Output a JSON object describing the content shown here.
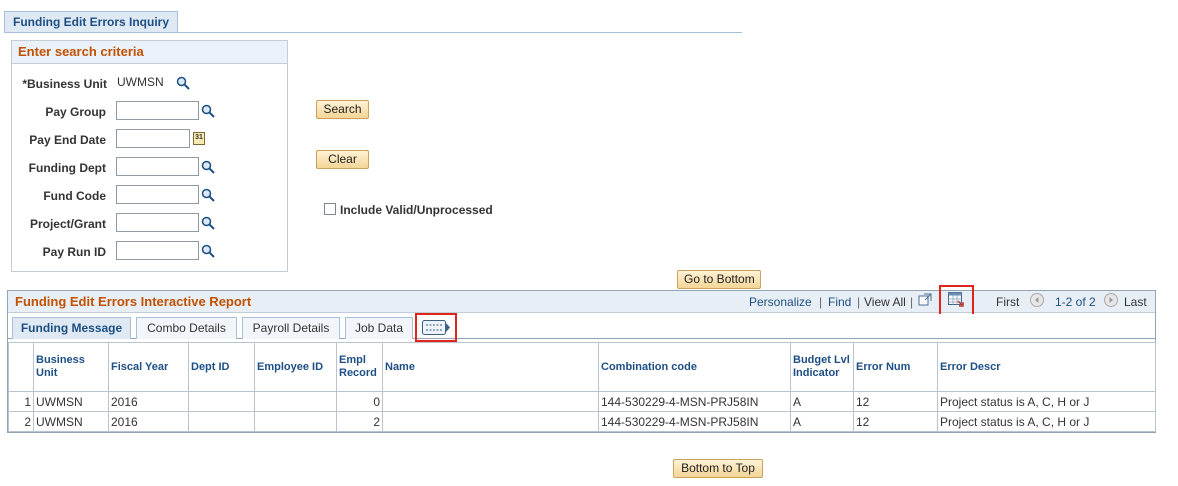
{
  "page_tab": {
    "label": "Funding Edit Errors Inquiry"
  },
  "criteria": {
    "title": "Enter search criteria",
    "business_unit": {
      "label": "*Business Unit",
      "value": "UWMSN"
    },
    "fields": [
      {
        "label": "Pay Group",
        "value": ""
      },
      {
        "label": "Pay End Date",
        "value": ""
      },
      {
        "label": "Funding Dept",
        "value": ""
      },
      {
        "label": "Fund Code",
        "value": ""
      },
      {
        "label": "Project/Grant",
        "value": ""
      },
      {
        "label": "Pay Run ID",
        "value": ""
      }
    ],
    "calendar_glyph": "31"
  },
  "buttons": {
    "search": "Search",
    "clear": "Clear",
    "go_to_bottom": "Go to Bottom",
    "bottom_to_top": "Bottom to Top"
  },
  "include_valid": {
    "label": "Include Valid/Unprocessed",
    "checked": false
  },
  "report": {
    "title": "Funding Edit Errors Interactive Report",
    "links": {
      "personalize": "Personalize",
      "find": "Find",
      "view_all": "View All",
      "sep": "|"
    },
    "nav": {
      "first": "First",
      "range": "1-2 of 2",
      "last": "Last"
    },
    "tabs": [
      "Funding Message",
      "Combo Details",
      "Payroll Details",
      "Job Data"
    ],
    "active_tab": 0,
    "columns": [
      "Business Unit",
      "Fiscal Year",
      "Dept ID",
      "Employee ID",
      "Empl Record",
      "Name",
      "Combination code",
      "Budget Lvl Indicator",
      "Error Num",
      "Error Descr"
    ],
    "rows": [
      {
        "num": "1",
        "business_unit": "UWMSN",
        "fiscal_year": "2016",
        "dept_id": "",
        "employee_id": "",
        "empl_record": "0",
        "name": "",
        "combination_code": "144-530229-4-MSN-PRJ58IN",
        "budget_lvl": "A",
        "error_num": "12",
        "error_descr": "Project status is A, C, H or J"
      },
      {
        "num": "2",
        "business_unit": "UWMSN",
        "fiscal_year": "2016",
        "dept_id": "",
        "employee_id": "",
        "empl_record": "2",
        "name": "",
        "combination_code": "144-530229-4-MSN-PRJ58IN",
        "budget_lvl": "A",
        "error_num": "12",
        "error_descr": "Project status is A, C, H or J"
      }
    ]
  },
  "colors": {
    "accent": "#c25100",
    "link": "#1d4f84",
    "highlight": "#e0251b"
  }
}
